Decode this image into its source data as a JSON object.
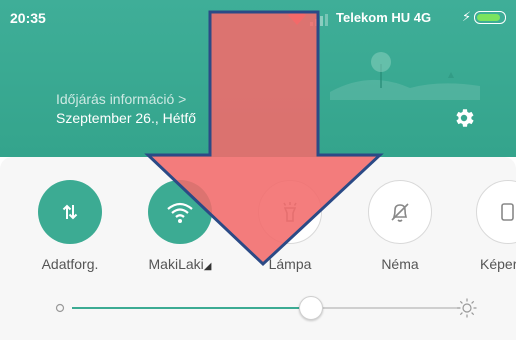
{
  "status_bar": {
    "time": "20:35",
    "carrier": "Telekom HU 4G",
    "battery_level": 0.9
  },
  "header": {
    "weather_info": "Időjárás információ >",
    "date": "Szeptember 26., Hétfő"
  },
  "quick_tiles": [
    {
      "label": "Adatforg.",
      "icon": "data-transfer-icon",
      "state": "on"
    },
    {
      "label": "MakiLaki",
      "icon": "wifi-icon",
      "state": "on"
    },
    {
      "label": "Lámpa",
      "icon": "flashlight-icon",
      "state": "off"
    },
    {
      "label": "Néma",
      "icon": "bell-off-icon",
      "state": "off"
    },
    {
      "label": "Képer",
      "icon": "rotate-icon",
      "state": "off"
    }
  ],
  "brightness": {
    "level": 0.62
  },
  "colors": {
    "accent": "#3cab93",
    "overlay_arrow": "#f26b6b",
    "overlay_outline": "#2b4a86"
  }
}
